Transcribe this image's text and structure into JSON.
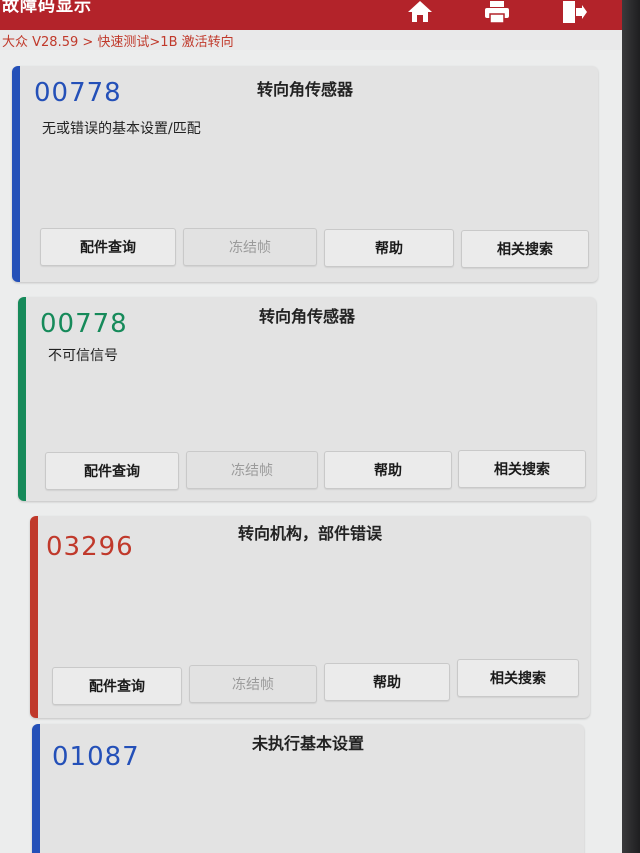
{
  "header": {
    "title": "故障码显示",
    "icons": [
      "home-icon",
      "print-icon",
      "exit-icon"
    ]
  },
  "breadcrumb": "大众 V28.59 > 快速测试>1B 激活转向",
  "buttons": {
    "parts": "配件查询",
    "freeze": "冻结帧",
    "help": "帮助",
    "search": "相关搜索"
  },
  "faults": [
    {
      "code": "00778",
      "title": "转向角传感器",
      "desc": "无或错误的基本设置/匹配",
      "color": "#2450b8"
    },
    {
      "code": "00778",
      "title": "转向角传感器",
      "desc": "不可信信号",
      "color": "#168a5a"
    },
    {
      "code": "03296",
      "title": "转向机构，部件错误",
      "desc": "",
      "color": "#c0392b"
    },
    {
      "code": "01087",
      "title": "未执行基本设置",
      "desc": "",
      "color": "#2450b8"
    }
  ]
}
